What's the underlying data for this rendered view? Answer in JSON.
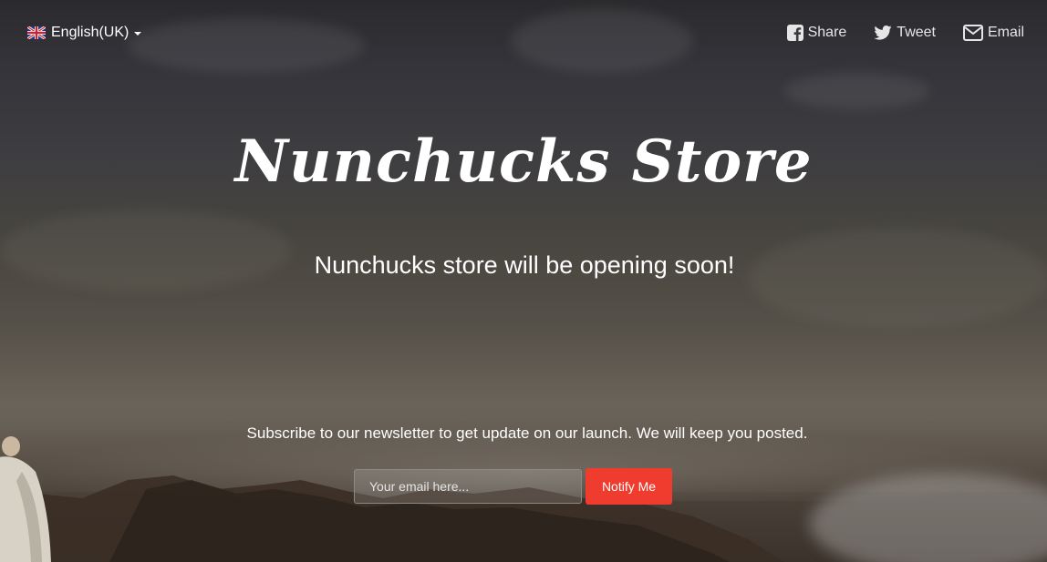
{
  "language": {
    "label": "English(UK)",
    "flag_icon": "uk-flag-icon"
  },
  "share": {
    "facebook": {
      "label": "Share",
      "icon": "facebook-icon"
    },
    "twitter": {
      "label": "Tweet",
      "icon": "twitter-icon"
    },
    "email": {
      "label": "Email",
      "icon": "envelope-icon"
    }
  },
  "hero": {
    "title": "Nunchucks Store",
    "tagline": "Nunchucks store will be opening soon!"
  },
  "newsletter": {
    "text": "Subscribe to our newsletter to get update on our launch. We will keep you posted.",
    "email_placeholder": "Your email here...",
    "button_label": "Notify Me"
  },
  "colors": {
    "accent": "#f03c2e",
    "text": "#ffffff"
  }
}
